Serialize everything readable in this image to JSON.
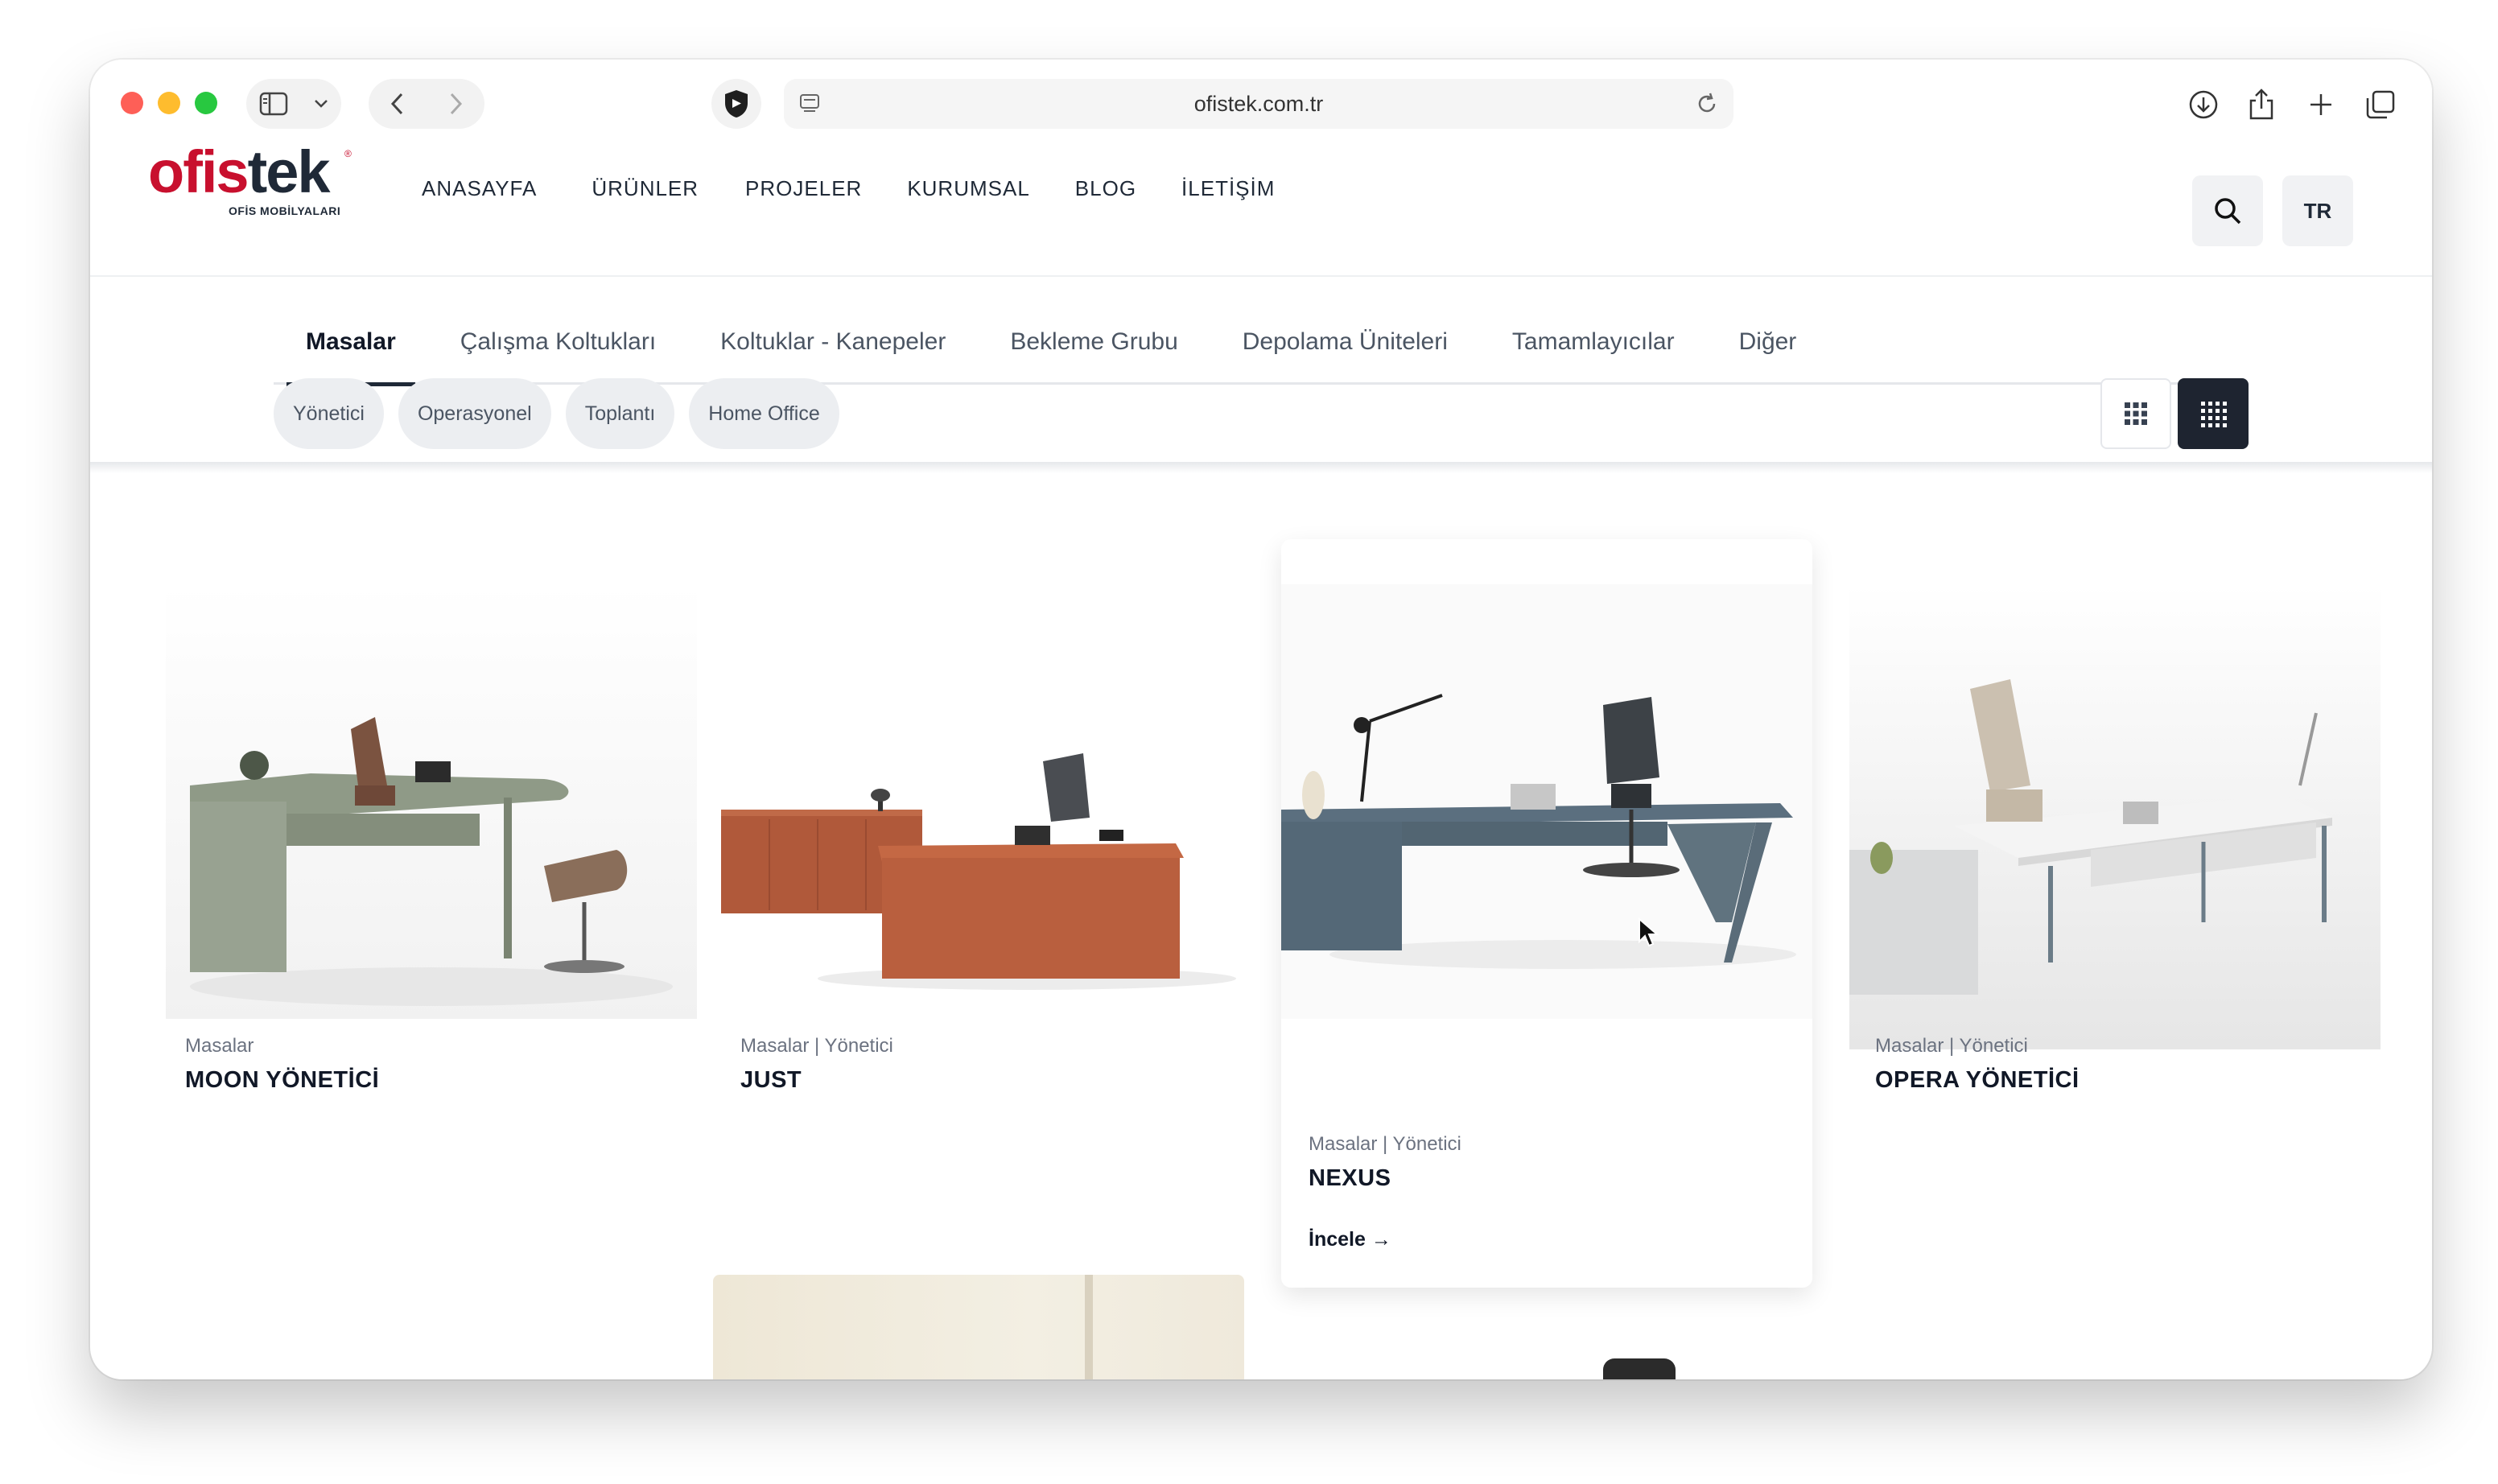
{
  "browser": {
    "url": "ofistek.com.tr"
  },
  "header": {
    "logo_main_a": "ofis",
    "logo_main_b": "tek",
    "logo_sub": "OFİS MOBİLYALARI",
    "logo_reg": "®",
    "nav": [
      "ANASAYFA",
      "ÜRÜNLER",
      "PROJELER",
      "KURUMSAL",
      "BLOG",
      "İLETİŞİM"
    ],
    "lang": "TR"
  },
  "categories": {
    "tabs": [
      "Masalar",
      "Çalışma Koltukları",
      "Koltuklar - Kanepeler",
      "Bekleme Grubu",
      "Depolama Üniteleri",
      "Tamamlayıcılar",
      "Diğer"
    ],
    "active": "Masalar"
  },
  "filters": {
    "chips": [
      "Yönetici",
      "Operasyonel",
      "Toplantı",
      "Home Office"
    ]
  },
  "products": [
    {
      "category": "Masalar",
      "name": "MOON YÖNETİCİ"
    },
    {
      "category": "Masalar | Yönetici",
      "name": "JUST"
    },
    {
      "category": "Masalar | Yönetici",
      "name": "NEXUS",
      "cta": "İncele →"
    },
    {
      "category": "Masalar | Yönetici",
      "name": "OPERA YÖNETİCİ"
    }
  ],
  "colors": {
    "brand_red": "#c8102e",
    "dark": "#1e2430"
  }
}
